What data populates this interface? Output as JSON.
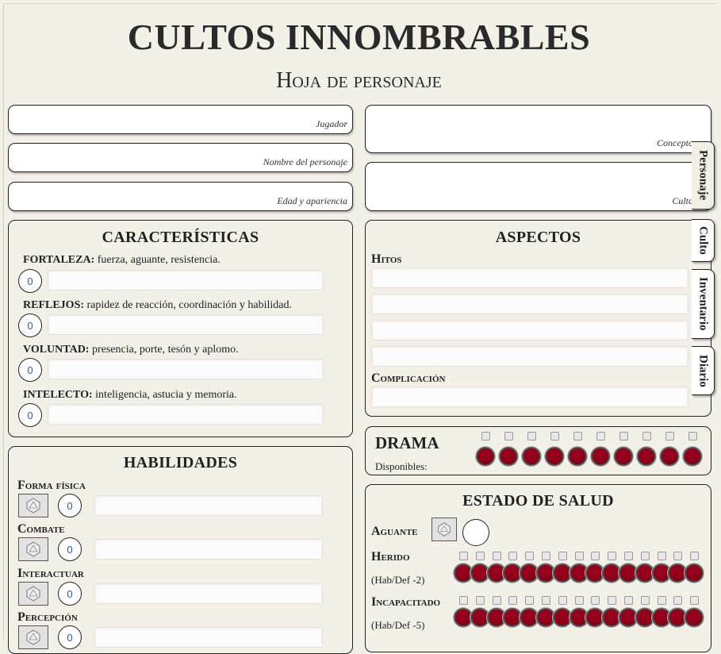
{
  "header": {
    "title": "CULTOS INNOMBRABLES",
    "subtitle": "Hoja de personaje"
  },
  "fields": {
    "player": "Jugador",
    "character_name": "Nombre del personaje",
    "age_appearance": "Edad y apariencia",
    "concept": "Concepto",
    "cult_field": "Culto"
  },
  "tabs": [
    "Personaje",
    "Culto",
    "Inventario",
    "Diario"
  ],
  "characteristics": {
    "title": "CARACTERÍSTICAS",
    "items": [
      {
        "name": "FORTALEZA:",
        "desc": " fuerza, aguante, resistencia.",
        "value": "0"
      },
      {
        "name": "REFLEJOS:",
        "desc": " rapidez de reacción, coordinación y habilidad.",
        "value": "0"
      },
      {
        "name": "VOLUNTAD:",
        "desc": " presencia, porte, tesón y aplomo.",
        "value": "0"
      },
      {
        "name": "INTELECTO:",
        "desc": " inteligencia, astucia y memoria.",
        "value": "0"
      }
    ]
  },
  "skills": {
    "title": "HABILIDADES",
    "items": [
      {
        "name": "Forma física",
        "value": "0"
      },
      {
        "name": "Combate",
        "value": "0"
      },
      {
        "name": "Interactuar",
        "value": "0"
      },
      {
        "name": "Percepción",
        "value": "0"
      }
    ]
  },
  "aspects": {
    "title": "ASPECTOS",
    "hitos_label": "Hitos",
    "complication_label": "Complicación"
  },
  "drama": {
    "title": "DRAMA",
    "available_label": "Disponibles:",
    "token_count": 10
  },
  "health": {
    "title": "ESTADO DE SALUD",
    "aguante_label": "Aguante",
    "herido_label": "Herido",
    "herido_penalty": "(Hab/Def -2)",
    "incapacitado_label": "Incapacitado",
    "incapacitado_penalty": "(Hab/Def -5)",
    "token_count": 15
  },
  "colors": {
    "background": "#f3f0e8",
    "token": "#8a0018",
    "value_text": "#3a55a5"
  }
}
